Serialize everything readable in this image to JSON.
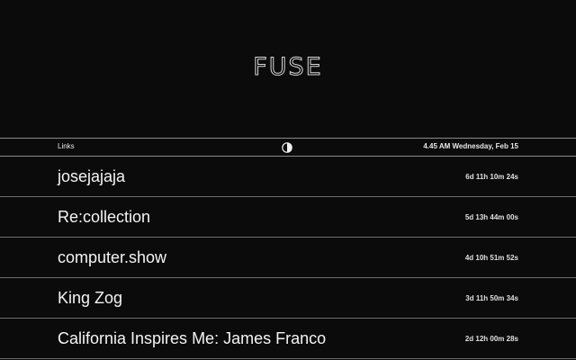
{
  "brand": {
    "logo_text": "FUSE"
  },
  "toolbar": {
    "links_label": "Links",
    "theme_icon": "half-circle-contrast-icon",
    "clock": "4.45 AM Wednesday, Feb 15"
  },
  "items": [
    {
      "title": "josejajaja",
      "countdown": "6d 11h 10m 24s"
    },
    {
      "title": "Re:collection",
      "countdown": "5d 13h 44m 00s"
    },
    {
      "title": "computer.show",
      "countdown": "4d 10h 51m 52s"
    },
    {
      "title": "King Zog",
      "countdown": "3d 11h 50m 34s"
    },
    {
      "title": "California Inspires Me: James Franco",
      "countdown": "2d 12h 00m 28s"
    }
  ]
}
